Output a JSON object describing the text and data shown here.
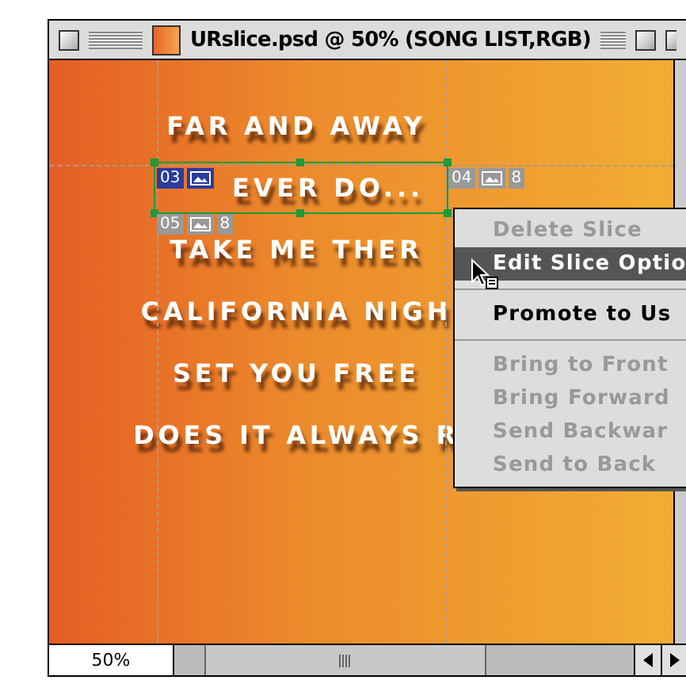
{
  "window": {
    "title": "URslice.psd @ 50% (SONG LIST,RGB)"
  },
  "canvas_lines": [
    {
      "text": "FAR AND AWAY"
    },
    {
      "text": "EVER DO..."
    },
    {
      "text": "TAKE ME THER"
    },
    {
      "text": "CALIFORNIA NIGH"
    },
    {
      "text": "SET YOU FREE"
    },
    {
      "text": "DOES IT ALWAYS R"
    }
  ],
  "slices": [
    {
      "number": "03",
      "selected": true
    },
    {
      "number": "04",
      "selected": false,
      "extra": "8"
    },
    {
      "number": "05",
      "selected": false,
      "extra": "8"
    }
  ],
  "context_menu": [
    {
      "kind": "item",
      "label": "Delete Slice",
      "disabled": true,
      "selected": false
    },
    {
      "kind": "item",
      "label": "Edit Slice Optio",
      "disabled": false,
      "selected": true
    },
    {
      "kind": "separator"
    },
    {
      "kind": "item",
      "label": "Promote to Us",
      "disabled": false,
      "selected": false
    },
    {
      "kind": "separator"
    },
    {
      "kind": "item",
      "label": "Bring to Front",
      "disabled": true,
      "selected": false
    },
    {
      "kind": "item",
      "label": "Bring Forward",
      "disabled": true,
      "selected": false
    },
    {
      "kind": "item",
      "label": "Send Backwar",
      "disabled": true,
      "selected": false
    },
    {
      "kind": "item",
      "label": "Send to Back",
      "disabled": true,
      "selected": false
    }
  ],
  "status_bar": {
    "zoom": "50%"
  }
}
